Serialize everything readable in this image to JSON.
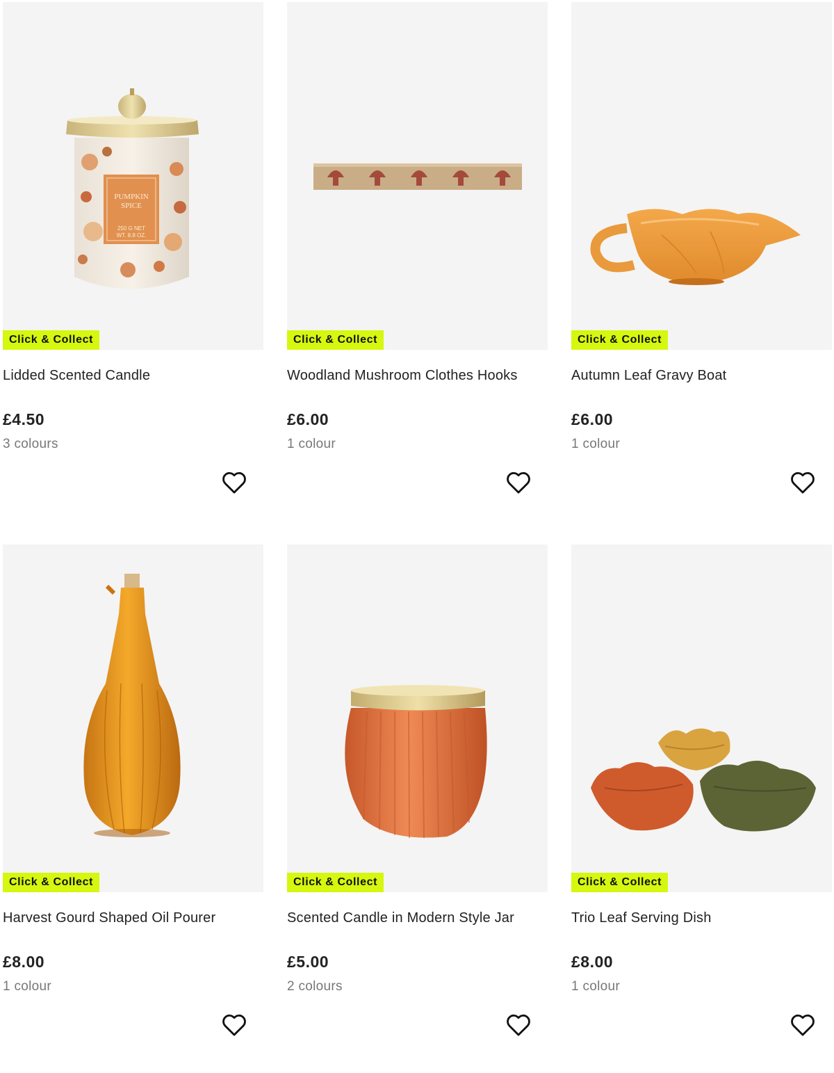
{
  "badge_label": "Click & Collect",
  "accent_color": "#d6f70f",
  "products": [
    {
      "name": "Lidded Scented Candle",
      "price": "£4.50",
      "colours": "3 colours",
      "icon": "lidded-candle-image"
    },
    {
      "name": "Woodland Mushroom Clothes Hooks",
      "price": "£6.00",
      "colours": "1 colour",
      "icon": "mushroom-hooks-image"
    },
    {
      "name": "Autumn Leaf Gravy Boat",
      "price": "£6.00",
      "colours": "1 colour",
      "icon": "gravy-boat-image"
    },
    {
      "name": "Harvest Gourd Shaped Oil Pourer",
      "price": "£8.00",
      "colours": "1 colour",
      "icon": "oil-pourer-image"
    },
    {
      "name": "Scented Candle in Modern Style Jar",
      "price": "£5.00",
      "colours": "2 colours",
      "icon": "candle-jar-image"
    },
    {
      "name": "Trio Leaf Serving Dish",
      "price": "£8.00",
      "colours": "1 colour",
      "icon": "leaf-dish-image"
    }
  ]
}
